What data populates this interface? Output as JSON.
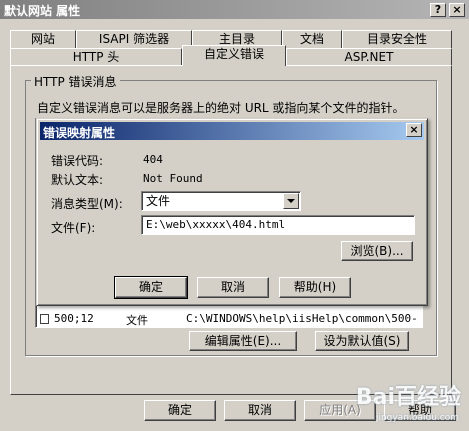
{
  "window": {
    "title": "默认网站 属性",
    "help_btn": "?",
    "close_btn": "×"
  },
  "tabs_row1": [
    "网站",
    "ISAPI 筛选器",
    "主目录",
    "文档",
    "目录安全性"
  ],
  "tabs_row2": [
    "HTTP 头",
    "自定义错误",
    "ASP.NET"
  ],
  "active_tab": "自定义错误",
  "group": {
    "legend": "HTTP 错误消息",
    "description": "自定义错误消息可以是服务器上的绝对 URL 或指向某个文件的指针。"
  },
  "error_list": {
    "visible_row": {
      "code": "500;12",
      "type": "文件",
      "path": "C:\\WINDOWS\\help\\iisHelp\\common\\500-"
    }
  },
  "list_buttons": {
    "edit": "编辑属性(E)...",
    "default": "设为默认值(S)"
  },
  "dialog": {
    "title": "错误映射属性",
    "close_btn": "×",
    "error_code_label": "错误代码:",
    "error_code_value": "404",
    "default_text_label": "默认文本:",
    "default_text_value": "Not Found",
    "msg_type_label": "消息类型(M):",
    "msg_type_value": "文件",
    "file_label": "文件(F):",
    "file_value": "E:\\web\\xxxxx\\404.html",
    "browse": "浏览(B)...",
    "ok": "确定",
    "cancel": "取消",
    "help": "帮助(H)"
  },
  "footer": {
    "ok": "确定",
    "cancel": "取消",
    "apply": "应用(A)",
    "help": "帮助"
  },
  "watermark": {
    "brand": "Bai百经验",
    "url": "jingyan.baidu.com"
  }
}
